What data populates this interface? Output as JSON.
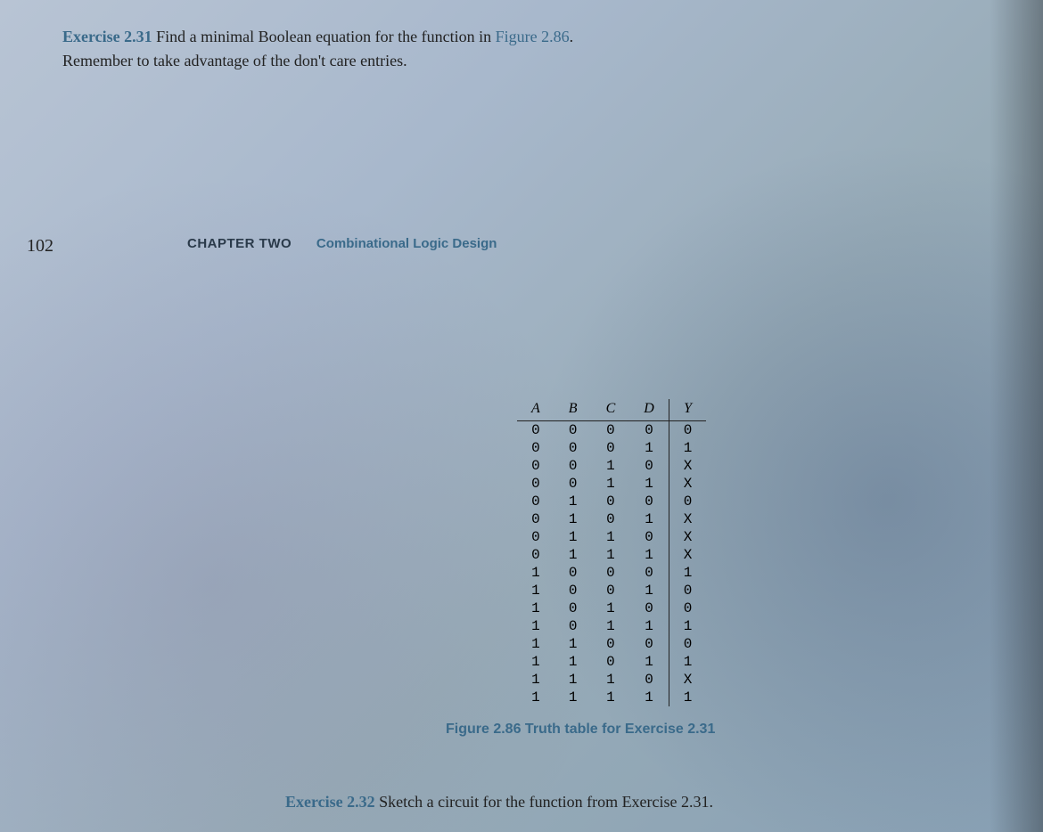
{
  "exercise_231": {
    "number": "Exercise 2.31",
    "text_part1": "Find a minimal Boolean equation for the function in ",
    "figure_ref": "Figure 2.86",
    "text_part2": ".",
    "text_line2": "Remember to take advantage of the don't care entries."
  },
  "page_number": "102",
  "chapter": {
    "label": "CHAPTER TWO",
    "title": "Combinational Logic Design"
  },
  "truth_table": {
    "headers": [
      "A",
      "B",
      "C",
      "D",
      "Y"
    ],
    "rows": [
      [
        "0",
        "0",
        "0",
        "0",
        "0"
      ],
      [
        "0",
        "0",
        "0",
        "1",
        "1"
      ],
      [
        "0",
        "0",
        "1",
        "0",
        "X"
      ],
      [
        "0",
        "0",
        "1",
        "1",
        "X"
      ],
      [
        "0",
        "1",
        "0",
        "0",
        "0"
      ],
      [
        "0",
        "1",
        "0",
        "1",
        "X"
      ],
      [
        "0",
        "1",
        "1",
        "0",
        "X"
      ],
      [
        "0",
        "1",
        "1",
        "1",
        "X"
      ],
      [
        "1",
        "0",
        "0",
        "0",
        "1"
      ],
      [
        "1",
        "0",
        "0",
        "1",
        "0"
      ],
      [
        "1",
        "0",
        "1",
        "0",
        "0"
      ],
      [
        "1",
        "0",
        "1",
        "1",
        "1"
      ],
      [
        "1",
        "1",
        "0",
        "0",
        "0"
      ],
      [
        "1",
        "1",
        "0",
        "1",
        "1"
      ],
      [
        "1",
        "1",
        "1",
        "0",
        "X"
      ],
      [
        "1",
        "1",
        "1",
        "1",
        "1"
      ]
    ]
  },
  "figure_caption": "Figure 2.86 Truth table for Exercise 2.31",
  "exercise_232": {
    "number": "Exercise 2.32",
    "text": "Sketch a circuit for the function from Exercise 2.31."
  }
}
